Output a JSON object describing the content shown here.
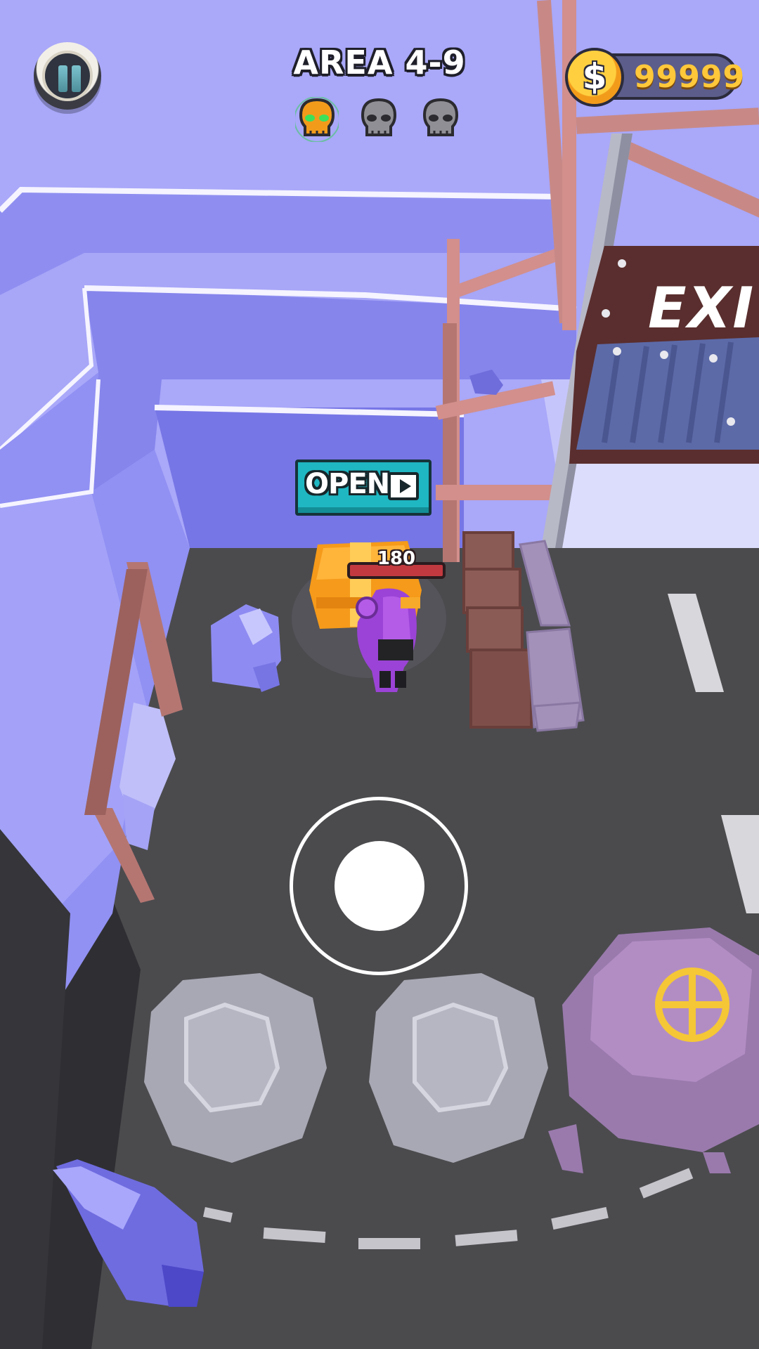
{
  "hud": {
    "area_title": "AREA 4-9",
    "coins": "99999",
    "coin_symbol": "$",
    "pause_icon": "pause-icon",
    "skulls": [
      {
        "state": "active",
        "color": "#f29b1b",
        "eyes": "#3ee05a"
      },
      {
        "state": "inactive",
        "color": "#8f8f95"
      },
      {
        "state": "inactive",
        "color": "#8f8f95"
      }
    ]
  },
  "chest": {
    "open_label": "OPEN",
    "open_icon": "play-icon"
  },
  "player": {
    "health": "180"
  },
  "scene": {
    "exit_sign": "EXI",
    "accent_colors": {
      "wall": "#a7a6f7",
      "ground": "#4a4a4c",
      "chest": "#f59a1a",
      "button": "#1fb7c2"
    }
  }
}
